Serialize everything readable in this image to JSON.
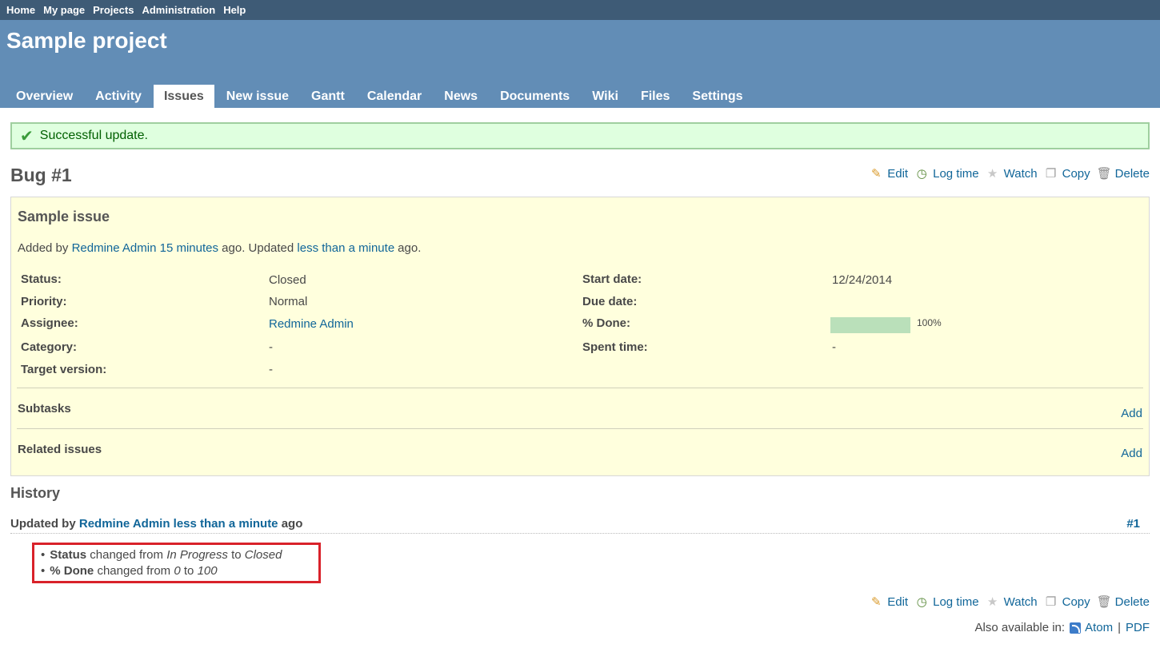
{
  "top_menu": [
    "Home",
    "My page",
    "Projects",
    "Administration",
    "Help"
  ],
  "project_title": "Sample project",
  "main_menu": [
    {
      "label": "Overview",
      "selected": false
    },
    {
      "label": "Activity",
      "selected": false
    },
    {
      "label": "Issues",
      "selected": true
    },
    {
      "label": "New issue",
      "selected": false
    },
    {
      "label": "Gantt",
      "selected": false
    },
    {
      "label": "Calendar",
      "selected": false
    },
    {
      "label": "News",
      "selected": false
    },
    {
      "label": "Documents",
      "selected": false
    },
    {
      "label": "Wiki",
      "selected": false
    },
    {
      "label": "Files",
      "selected": false
    },
    {
      "label": "Settings",
      "selected": false
    }
  ],
  "flash": {
    "icon": "check-icon",
    "message": "Successful update."
  },
  "issue": {
    "title": "Bug #1",
    "subject": "Sample issue",
    "author_line": {
      "prefix": "Added by",
      "author": "Redmine Admin",
      "created": "15 minutes",
      "middle": "ago. Updated",
      "updated": "less than a minute",
      "suffix": "ago."
    },
    "attributes_left": [
      {
        "label": "Status:",
        "value": "Closed",
        "link": false
      },
      {
        "label": "Priority:",
        "value": "Normal",
        "link": false
      },
      {
        "label": "Assignee:",
        "value": "Redmine Admin",
        "link": true
      },
      {
        "label": "Category:",
        "value": "-",
        "link": false
      },
      {
        "label": "Target version:",
        "value": "-",
        "link": false
      }
    ],
    "attributes_right": [
      {
        "label": "Start date:",
        "value": "12/24/2014"
      },
      {
        "label": "Due date:",
        "value": ""
      },
      {
        "label": "% Done:",
        "value": "100%",
        "progress": 1.0
      },
      {
        "label": "Spent time:",
        "value": "-"
      }
    ],
    "subtasks": {
      "title": "Subtasks",
      "add": "Add"
    },
    "related": {
      "title": "Related issues",
      "add": "Add"
    }
  },
  "actions": {
    "edit": "Edit",
    "log_time": "Log time",
    "watch": "Watch",
    "copy": "Copy",
    "delete": "Delete"
  },
  "history": {
    "title": "History",
    "journal": {
      "prefix": "Updated by",
      "author": "Redmine Admin",
      "time": "less than a minute",
      "suffix": "ago",
      "number": "#1",
      "details": [
        {
          "field": "Status",
          "text1": "changed from",
          "old": "In Progress",
          "text2": "to",
          "new": "Closed"
        },
        {
          "field": "% Done",
          "text1": "changed from",
          "old": "0",
          "text2": "to",
          "new": "100"
        }
      ]
    }
  },
  "other_formats": {
    "label": "Also available in:",
    "atom": "Atom",
    "separator": "|",
    "pdf": "PDF"
  },
  "colors": {
    "header": "#628db6",
    "top_menu": "#3e5b76",
    "issue_box": "#ffffdd",
    "flash_bg": "#dfffdf",
    "link": "#116699",
    "highlight_border": "#d9222a",
    "progress": "#bae0ba"
  }
}
